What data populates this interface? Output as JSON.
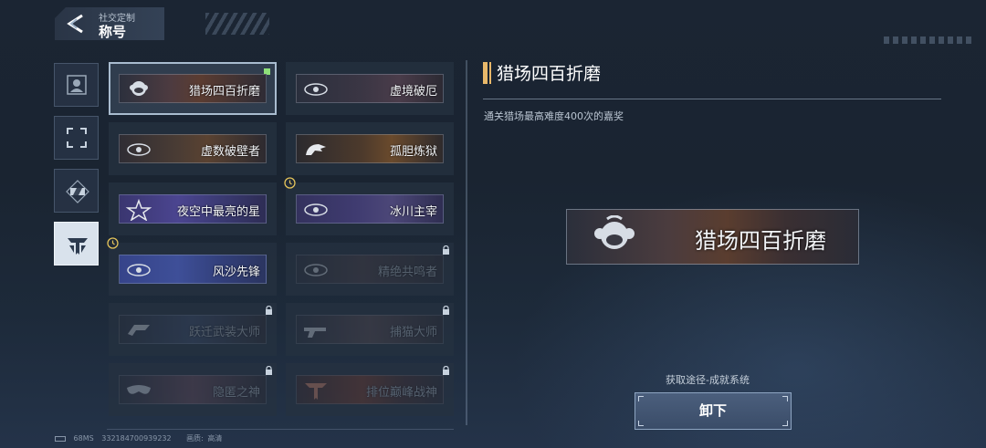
{
  "header": {
    "subtitle": "社交定制",
    "title": "称号"
  },
  "side_tabs": [
    {
      "icon": "portrait-icon",
      "active": false
    },
    {
      "icon": "frame-icon",
      "active": false
    },
    {
      "icon": "badge-icon",
      "active": false
    },
    {
      "icon": "title-emblem-icon",
      "active": true
    }
  ],
  "titles": [
    {
      "label": "猎场四百折磨",
      "state": "selected",
      "new": true
    },
    {
      "label": "虚境破厄",
      "state": "unlocked"
    },
    {
      "label": "虚数破壁者",
      "state": "unlocked"
    },
    {
      "label": "孤胆炼狱",
      "state": "unlocked"
    },
    {
      "label": "夜空中最亮的星",
      "state": "unlocked"
    },
    {
      "label": "冰川主宰",
      "state": "timed"
    },
    {
      "label": "风沙先锋",
      "state": "timed"
    },
    {
      "label": "精绝共鸣者",
      "state": "locked"
    },
    {
      "label": "跃迁武装大师",
      "state": "locked"
    },
    {
      "label": "捕猫大师",
      "state": "locked"
    },
    {
      "label": "隐匿之神",
      "state": "locked"
    },
    {
      "label": "排位巅峰战神",
      "state": "locked"
    }
  ],
  "detail": {
    "title": "猎场四百折磨",
    "description": "通关猎场最高难度400次的嘉奖",
    "banner_label": "猎场四百折磨",
    "source": "获取途径-成就系统",
    "button": "卸下"
  },
  "footer": {
    "ping": "68MS",
    "uid": "332184700939232",
    "quality_label": "画质:",
    "quality": "高清"
  },
  "colors": {
    "accent": "#e8b86a",
    "new_badge": "#8ee07a",
    "timed": "#e2c25a"
  }
}
